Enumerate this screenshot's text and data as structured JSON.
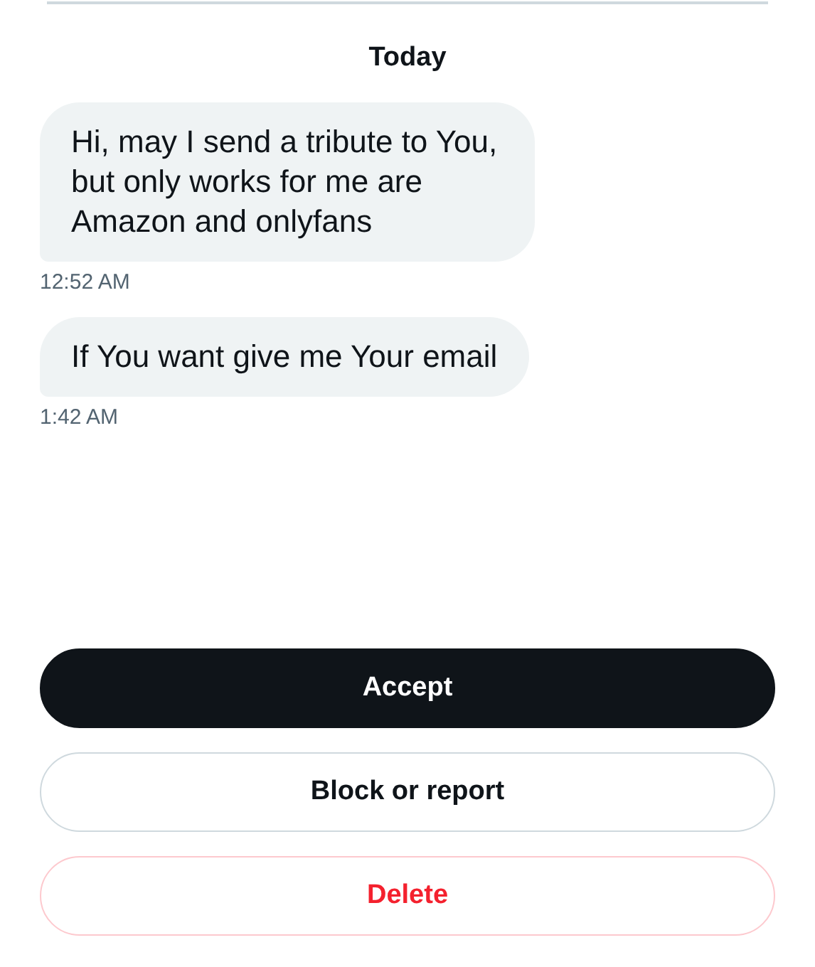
{
  "date_header": "Today",
  "messages": [
    {
      "text": "Hi, may I send a tribute to You, but only works for me are Amazon and onlyfans",
      "time": "12:52 AM"
    },
    {
      "text": "If You want give me Your email",
      "time": "1:42 AM"
    }
  ],
  "actions": [
    {
      "label": "Accept",
      "kind": "primary"
    },
    {
      "label": "Block or report",
      "kind": "outline"
    },
    {
      "label": "Delete",
      "kind": "danger"
    }
  ]
}
